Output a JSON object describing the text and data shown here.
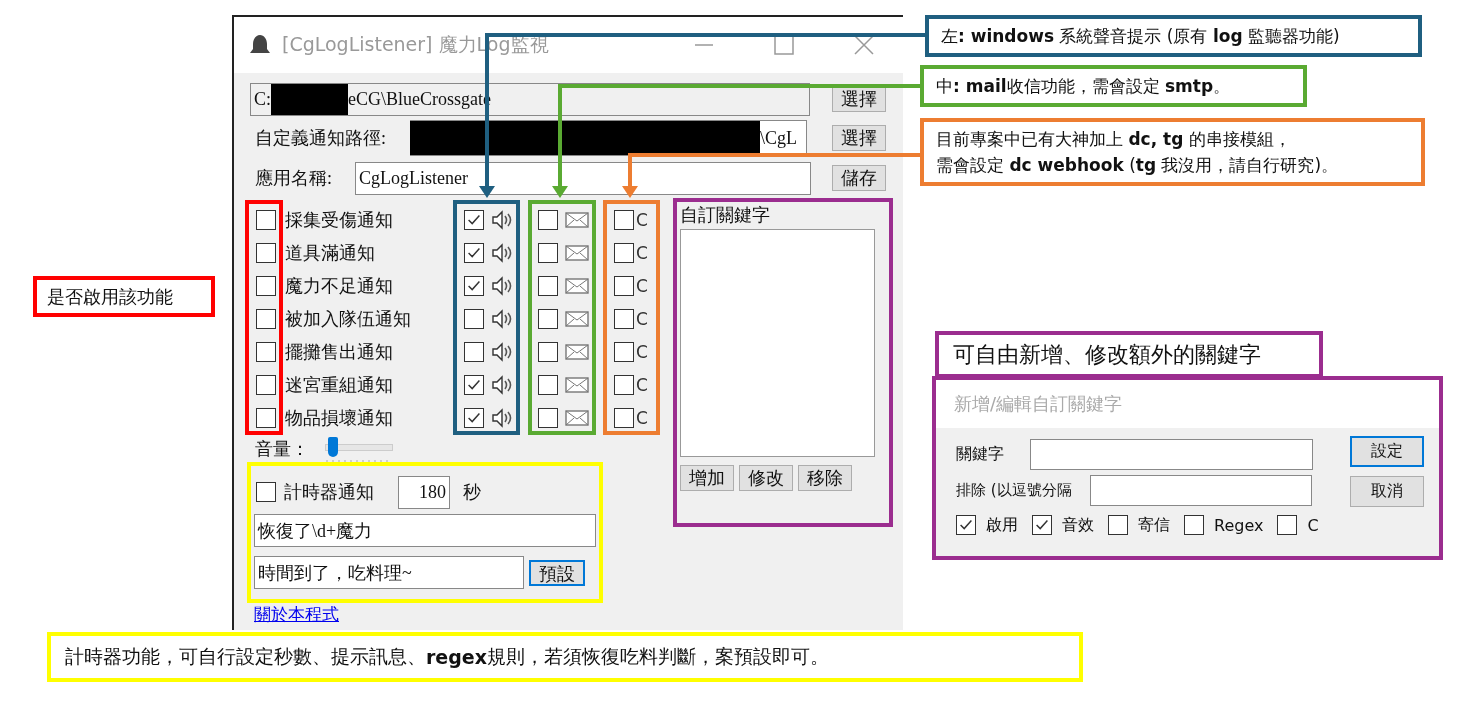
{
  "window": {
    "title": "[CgLogListener] 魔力Log監視"
  },
  "game_path": {
    "prefix": "C:",
    "suffix": "eCG\\BlueCrossgate",
    "button": "選擇"
  },
  "notify_path": {
    "label": "自定義通知路徑:",
    "value": "\\CgL",
    "button": "選擇"
  },
  "app_name": {
    "label": "應用名稱:",
    "value": "CgLogListener",
    "button": "儲存"
  },
  "notifications": [
    {
      "label": "採集受傷通知",
      "enabled": false,
      "sound": true,
      "mail": false,
      "c": false,
      "c_label": "C"
    },
    {
      "label": "道具滿通知",
      "enabled": false,
      "sound": true,
      "mail": false,
      "c": false,
      "c_label": "C"
    },
    {
      "label": "魔力不足通知",
      "enabled": false,
      "sound": true,
      "mail": false,
      "c": false,
      "c_label": "C"
    },
    {
      "label": "被加入隊伍通知",
      "enabled": false,
      "sound": false,
      "mail": false,
      "c": false,
      "c_label": "C"
    },
    {
      "label": "擺攤售出通知",
      "enabled": false,
      "sound": false,
      "mail": false,
      "c": false,
      "c_label": "C"
    },
    {
      "label": "迷宮重組通知",
      "enabled": false,
      "sound": true,
      "mail": false,
      "c": false,
      "c_label": "C"
    },
    {
      "label": "物品損壞通知",
      "enabled": false,
      "sound": true,
      "mail": false,
      "c": false,
      "c_label": "C"
    }
  ],
  "keywords": {
    "title": "自訂關鍵字",
    "buttons": [
      "增加",
      "修改",
      "移除"
    ]
  },
  "volume": {
    "label": "音量：",
    "level": 0.05
  },
  "timer": {
    "label": "計時器通知",
    "checked": false,
    "seconds": "180",
    "unit": "秒",
    "regex": "恢復了\\d+魔力",
    "message": "時間到了，吃料理~",
    "default_button": "預設"
  },
  "about_link": "關於本程式",
  "callouts": [
    {
      "color": "#1f5f80",
      "lines": [
        "左**: windows** 系統聲音提示 (原有 **log** 監聽器功能)"
      ]
    },
    {
      "color": "#5aaa32",
      "lines": [
        "中**: mail**收信功能，需會設定 **smtp**。"
      ]
    },
    {
      "color": "#ed7d31",
      "lines": [
        "目前專案中已有大神加上 **dc, tg** 的串接模組，",
        "需會設定 **dc webhook** (**tg** 我沒用，請自行研究)。"
      ]
    }
  ],
  "side_note": {
    "text": "是否啟用該功能",
    "color": "#ff0000"
  },
  "keyword_note": {
    "text": "可自由新增、修改額外的關鍵字",
    "color": "#9b2d8f"
  },
  "dialog": {
    "title": "新增/編輯自訂關鍵字",
    "fields": [
      {
        "label": "關鍵字"
      },
      {
        "label": "排除 (以逗號分隔"
      }
    ],
    "options": [
      {
        "label": "啟用",
        "checked": true
      },
      {
        "label": "音效",
        "checked": true
      },
      {
        "label": "寄信",
        "checked": false
      },
      {
        "label": "Regex",
        "checked": false
      },
      {
        "label": "C",
        "checked": false
      }
    ],
    "buttons": [
      {
        "label": "設定",
        "focused": true
      },
      {
        "label": "取消",
        "focused": false
      }
    ]
  },
  "timer_note": {
    "text": "計時器功能，可自行設定秒數、提示訊息、**regex**規則，若須恢復吃料判斷，案預設即可。",
    "color": "#ffff00"
  }
}
